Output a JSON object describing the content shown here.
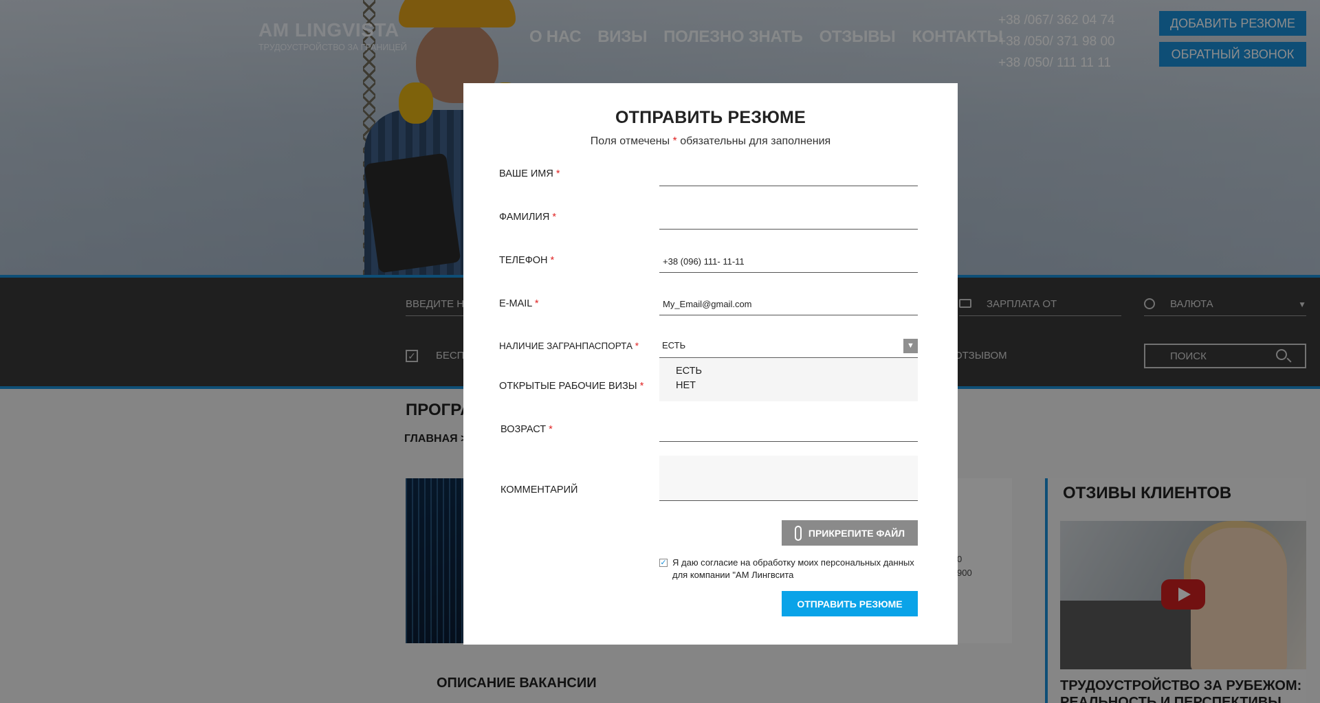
{
  "header": {
    "logo_name": "AM LINGVISTA",
    "logo_tagline": "ТРУДОУСТРОЙСТВО ЗА ГРАНИЦЕЙ",
    "nav": [
      "О НАС",
      "ВИЗЫ",
      "ПОЛЕЗНО ЗНАТЬ",
      "ОТЗЫВЫ",
      "КОНТАКТЫ"
    ],
    "phones": [
      "+38 /067/ 362 04 74",
      "+38 /050/ 371 98 00",
      "+38 /050/ 111 11 11"
    ],
    "add_resume_button": "ДОБАВИТЬ РЕЗЮМЕ",
    "callback_button": "ОБРАТНЫЙ ЗВОНОК"
  },
  "filters": {
    "search_placeholder_partial": "ВВЕДИТЕ НА",
    "salary_placeholder": "ЗАРПЛАТА ОТ",
    "currency_label": "ВАЛЮТА",
    "free_partial": "БЕСП",
    "review_partial": "ОТЗЫВОМ",
    "search_button": "ПОИСК"
  },
  "page": {
    "title_partial": "ПРОГРА",
    "breadcrumb_partial": "ГЛАВНАЯ >",
    "side_values": [
      "0",
      "900"
    ],
    "description_title": "ОПИСАНИЕ ВАКАНСИИ",
    "reviews_title": "ОТЗИВЫ КЛИЕНТОВ",
    "reviews_article_title": "ТРУДОУСТРОЙСТВО ЗА РУБЕЖОМ: РЕАЛЬНОСТЬ И ПЕРСПЕКТИВЫ"
  },
  "modal": {
    "title": "ОТПРАВИТЬ РЕЗЮМЕ",
    "subtitle_before": "Поля отмечены ",
    "subtitle_star": "*",
    "subtitle_after": " обязательны для заполнения",
    "required_mark": "*",
    "fields": {
      "first_name": {
        "label": "ВАШЕ ИМЯ",
        "value": ""
      },
      "last_name": {
        "label": "ФАМИЛИЯ",
        "value": ""
      },
      "phone": {
        "label": "ТЕЛЕФОН",
        "value": "+38 (096) 111- 11-11"
      },
      "email": {
        "label": "E-MAIL",
        "value": "My_Email@gmail.com"
      },
      "passport": {
        "label": "НАЛИЧИЕ ЗАГРАНПАСПОРТА",
        "value": "ЕСТЬ",
        "options": [
          "ЕСТЬ",
          "НЕТ"
        ]
      },
      "visas": {
        "label": "ОТКРЫТЫЕ РАБОЧИЕ ВИЗЫ"
      },
      "age": {
        "label": "ВОЗРАСТ",
        "value": ""
      },
      "comment": {
        "label": "КОММЕНТАРИЙ",
        "value": ""
      }
    },
    "attach_button": "ПРИКРЕПИТЕ ФАЙЛ",
    "consent_checked": true,
    "consent_text": "Я даю согласие на обработку моих персональных данных для компании \"АМ Лингвсита",
    "submit_button": "ОТПРАВИТЬ РЕЗЮМЕ"
  },
  "colors": {
    "accent": "#1a8fd8",
    "submit": "#0aa3e8",
    "required": "#e02424",
    "attach": "#8a8a8a"
  }
}
